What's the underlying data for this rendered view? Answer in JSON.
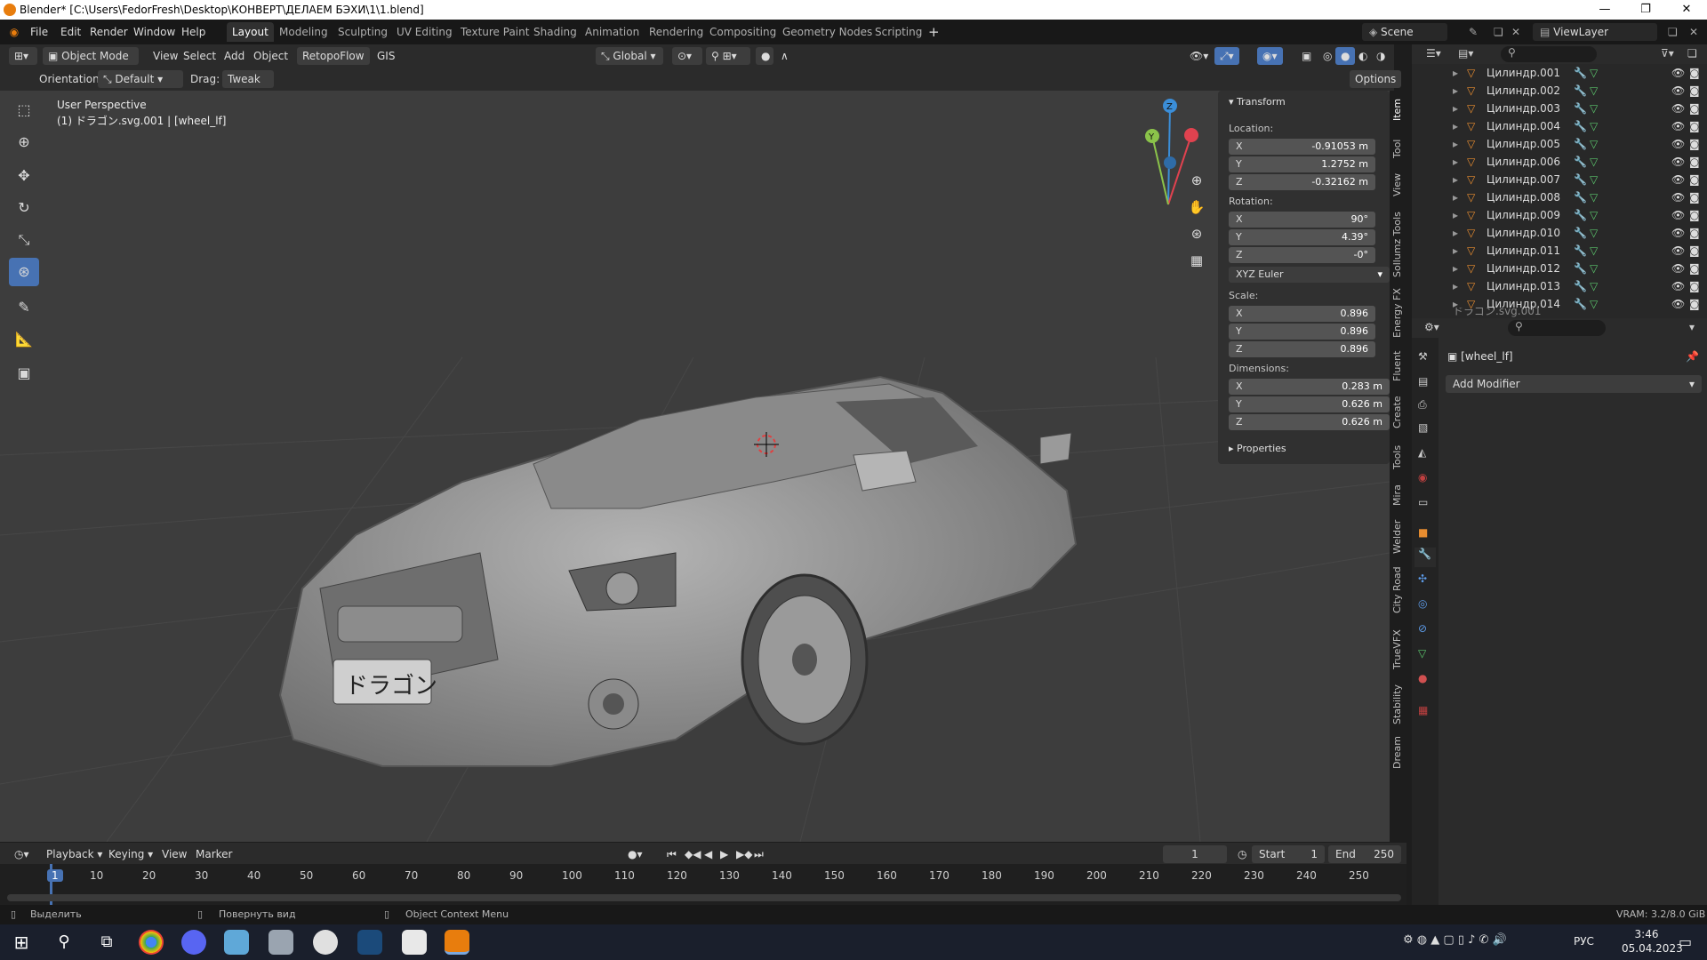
{
  "titlebar": {
    "title": "Blender* [C:\\Users\\FedorFresh\\Desktop\\КОНВЕРТ\\ДЕЛАЕМ БЭХИ\\1\\1.blend]"
  },
  "menu": [
    "File",
    "Edit",
    "Render",
    "Window",
    "Help"
  ],
  "workspaces": [
    "Layout",
    "Modeling",
    "Sculpting",
    "UV Editing",
    "Texture Paint",
    "Shading",
    "Animation",
    "Rendering",
    "Compositing",
    "Geometry Nodes",
    "Scripting"
  ],
  "active_workspace": "Layout",
  "scene": {
    "label": "Scene",
    "viewlayer": "ViewLayer"
  },
  "header3d": {
    "mode": "Object Mode",
    "items": [
      "View",
      "Select",
      "Add",
      "Object",
      "RetopoFlow",
      "GIS"
    ],
    "transform": "Global"
  },
  "toolhdr": {
    "orientation_label": "Orientation:",
    "orientation_value": "Default",
    "drag_label": "Drag:",
    "drag_value": "Tweak",
    "options": "Options"
  },
  "viewport": {
    "perspective": "User Perspective",
    "object_info": "(1) ドラゴン.svg.001 | [wheel_lf]",
    "gizmo": {
      "x": "X",
      "y": "Y",
      "z": "Z"
    },
    "plate_text": "ドラゴン"
  },
  "npanel": {
    "transform_title": "Transform",
    "location_label": "Location:",
    "location": [
      {
        "axis": "X",
        "value": "-0.91053 m"
      },
      {
        "axis": "Y",
        "value": "1.2752 m"
      },
      {
        "axis": "Z",
        "value": "-0.32162 m"
      }
    ],
    "rotation_label": "Rotation:",
    "rotation": [
      {
        "axis": "X",
        "value": "90°"
      },
      {
        "axis": "Y",
        "value": "4.39°"
      },
      {
        "axis": "Z",
        "value": "-0°"
      }
    ],
    "rotation_mode": "XYZ Euler",
    "scale_label": "Scale:",
    "scale": [
      {
        "axis": "X",
        "value": "0.896"
      },
      {
        "axis": "Y",
        "value": "0.896"
      },
      {
        "axis": "Z",
        "value": "0.896"
      }
    ],
    "dimensions_label": "Dimensions:",
    "dimensions": [
      {
        "axis": "X",
        "value": "0.283 m"
      },
      {
        "axis": "Y",
        "value": "0.626 m"
      },
      {
        "axis": "Z",
        "value": "0.626 m"
      }
    ],
    "properties_title": "Properties"
  },
  "side_tabs": [
    "Item",
    "Tool",
    "View",
    "Sollumz Tools",
    "Energy FX",
    "Fluent",
    "Create",
    "Tools",
    "Mira",
    "Welder",
    "City Road",
    "TrueVFX",
    "Stability",
    "Dream"
  ],
  "outliner": {
    "items": [
      "Цилиндр.001",
      "Цилиндр.002",
      "Цилиндр.003",
      "Цилиндр.004",
      "Цилиндр.005",
      "Цилиндр.006",
      "Цилиндр.007",
      "Цилиндр.008",
      "Цилиндр.009",
      "Цилиндр.010",
      "Цилиндр.011",
      "Цилиндр.012",
      "Цилиндр.013",
      "Цилиндр.014"
    ],
    "partial_item": "ドラゴン.svg.001"
  },
  "properties": {
    "object_name": "[wheel_lf]",
    "add_modifier": "Add Modifier"
  },
  "timeline": {
    "menu": [
      "Playback",
      "Keying",
      "View",
      "Marker"
    ],
    "current_frame": "1",
    "start_label": "Start",
    "start": "1",
    "end_label": "End",
    "end": "250",
    "ticks": [
      "1",
      "10",
      "20",
      "30",
      "40",
      "50",
      "60",
      "70",
      "80",
      "90",
      "100",
      "110",
      "120",
      "130",
      "140",
      "150",
      "160",
      "170",
      "180",
      "190",
      "200",
      "210",
      "220",
      "230",
      "240",
      "250"
    ]
  },
  "statusbar": {
    "select": "Выделить",
    "rotate": "Повернуть вид",
    "context": "Object Context Menu",
    "vram": "VRAM: 3.2/8.0 GiB"
  },
  "taskbar": {
    "lang": "РУС",
    "time": "3:46",
    "date": "05.04.2023"
  },
  "colors": {
    "accent": "#4772b3",
    "blender_orange": "#e87d0d",
    "viewport_bg": "#3d3d3d",
    "axis_x": "#e0424f",
    "axis_y": "#8bc34a",
    "axis_z": "#3b8ed8"
  }
}
